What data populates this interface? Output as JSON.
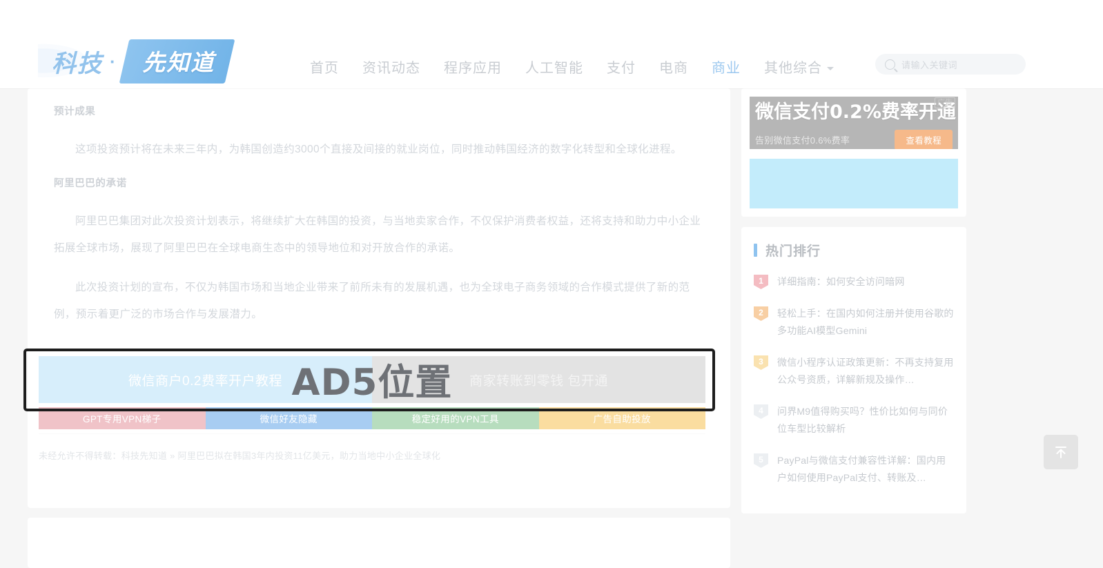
{
  "header": {
    "logo": {
      "text": "科技",
      "dot": "·",
      "badge": "先知道"
    },
    "nav": [
      {
        "label": "首页",
        "active": false
      },
      {
        "label": "资讯动态",
        "active": false
      },
      {
        "label": "程序应用",
        "active": false
      },
      {
        "label": "人工智能",
        "active": false
      },
      {
        "label": "支付",
        "active": false
      },
      {
        "label": "电商",
        "active": false
      },
      {
        "label": "商业",
        "active": true
      },
      {
        "label": "其他综合",
        "active": false,
        "has_caret": true
      }
    ],
    "search": {
      "placeholder": "请输入关键词",
      "icon": "search-icon"
    },
    "accent_color": "#8fc3ef"
  },
  "article": {
    "section1_title": "预计成果",
    "para1": "这项投资预计将在未来三年内，为韩国创造约3000个直接及间接的就业岗位，同时推动韩国经济的数字化转型和全球化进程。",
    "section2_title": "阿里巴巴的承诺",
    "para2": "阿里巴巴集团对此次投资计划表示，将继续扩大在韩国的投资，与当地卖家合作，不仅保护消费者权益，还将支持和助力中小企业拓展全球市场，展现了阿里巴巴在全球电商生态中的领导地位和对开放合作的承诺。",
    "para3": "此次投资计划的宣布，不仅为韩国市场和当地企业带来了前所未有的发展机遇，也为全球电子商务领域的合作模式提供了新的范例，预示着更广泛的市场合作与发展潜力。",
    "copyright": "未经允许不得转载：科技先知道 » 阿里巴巴拟在韩国3年内投资11亿美元，助力当地中小企业全球化"
  },
  "ad_slot": {
    "overlay_label": "AD5位置",
    "banners": [
      {
        "text": "微信商户0.2费率开户教程",
        "bg": "#d7eefb"
      },
      {
        "text": "商家转账到零钱 包开通",
        "bg": "#e3e3e3"
      }
    ],
    "tags": [
      {
        "label": "GPT专用VPN梯子",
        "color": "#f0c3c8"
      },
      {
        "label": "微信好友隐藏",
        "color": "#a8cdf2"
      },
      {
        "label": "稳定好用的VPN工具",
        "color": "#b7ddbe"
      },
      {
        "label": "广告自助投放",
        "color": "#fadda0"
      }
    ]
  },
  "sidebar": {
    "ad": {
      "title": "微信支付0.2%费率开通",
      "subtitle": "告别微信支付0.6%费率",
      "button": "查看教程",
      "flag": "广告",
      "button_color": "#f6b98a"
    },
    "rank": {
      "title": "热门排行",
      "items": [
        {
          "num": "1",
          "text": "详细指南：如何安全访问暗网"
        },
        {
          "num": "2",
          "text": "轻松上手：在国内如何注册并使用谷歌的多功能AI模型Gemini"
        },
        {
          "num": "3",
          "text": "微信小程序认证政策更新：不再支持复用公众号资质，详解新规及操作…"
        },
        {
          "num": "4",
          "text": "问界M9值得购买吗？性价比如何与同价位车型比较解析"
        },
        {
          "num": "5",
          "text": "PayPal与微信支付兼容性详解：国内用户如何使用PayPal支付、转账及…"
        }
      ]
    }
  },
  "back_to_top": {
    "icon": "arrow-up-to-line-icon"
  }
}
